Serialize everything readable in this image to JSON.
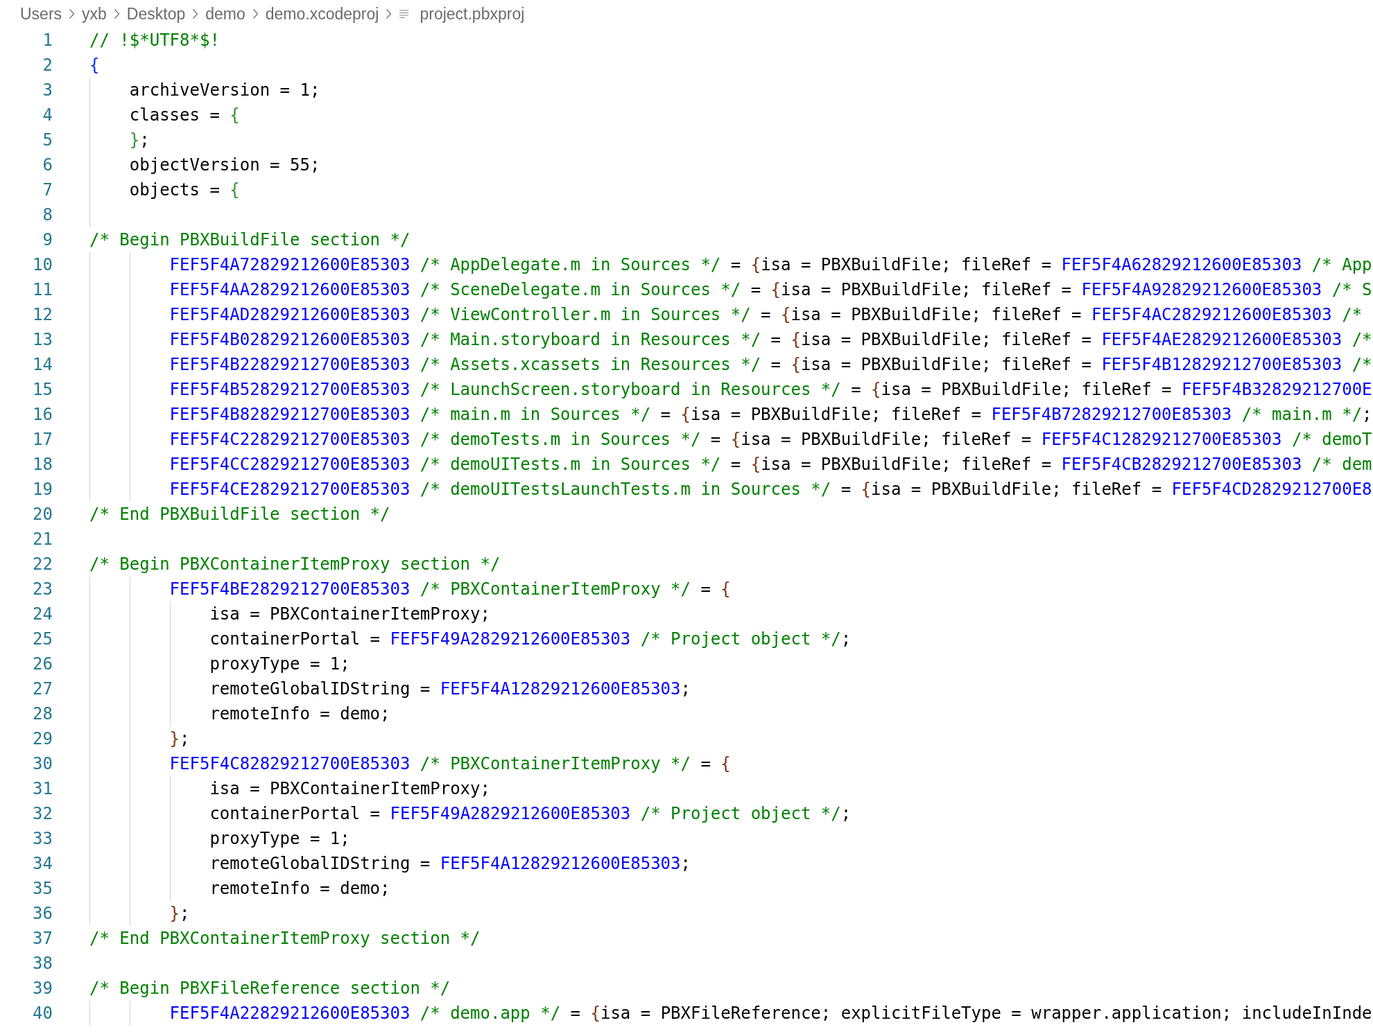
{
  "breadcrumb": {
    "items": [
      {
        "label": "Users",
        "kind": "folder"
      },
      {
        "label": "yxb",
        "kind": "folder"
      },
      {
        "label": "Desktop",
        "kind": "folder"
      },
      {
        "label": "demo",
        "kind": "folder"
      },
      {
        "label": "demo.xcodeproj",
        "kind": "folder"
      },
      {
        "label": "project.pbxproj",
        "kind": "file"
      }
    ]
  },
  "editor": {
    "lines": [
      {
        "number": "1",
        "tokens": [
          {
            "kind": "comment",
            "text": "// !$*UTF8*$!"
          }
        ]
      },
      {
        "number": "2",
        "tokens": [
          {
            "kind": "brace1",
            "text": "{"
          }
        ]
      },
      {
        "number": "3",
        "tokens": [
          {
            "kind": "plain",
            "text": "    archiveVersion = 1;"
          }
        ]
      },
      {
        "number": "4",
        "tokens": [
          {
            "kind": "plain",
            "text": "    classes = "
          },
          {
            "kind": "brace2",
            "text": "{"
          }
        ]
      },
      {
        "number": "5",
        "tokens": [
          {
            "kind": "brace2",
            "text": "    }"
          },
          {
            "kind": "plain",
            "text": ";"
          }
        ]
      },
      {
        "number": "6",
        "tokens": [
          {
            "kind": "plain",
            "text": "    objectVersion = 55;"
          }
        ]
      },
      {
        "number": "7",
        "tokens": [
          {
            "kind": "plain",
            "text": "    objects = "
          },
          {
            "kind": "brace2",
            "text": "{"
          }
        ]
      },
      {
        "number": "8"
      },
      {
        "number": "9",
        "tokens": [
          {
            "kind": "comment",
            "text": "/* Begin PBXBuildFile section */"
          }
        ]
      },
      {
        "number": "10",
        "tokens": [
          {
            "kind": "id",
            "text": "        FEF5F4A72829212600E85303"
          },
          {
            "kind": "comment",
            "text": " /* AppDelegate.m in Sources */"
          },
          {
            "kind": "plain",
            "text": " = "
          },
          {
            "kind": "brace3",
            "text": "{"
          },
          {
            "kind": "plain",
            "text": "isa = PBXBuildFile; fileRef = "
          },
          {
            "kind": "id",
            "text": "FEF5F4A62829212600E85303"
          },
          {
            "kind": "comment",
            "text": " /* App"
          }
        ]
      },
      {
        "number": "11",
        "tokens": [
          {
            "kind": "id",
            "text": "        FEF5F4AA2829212600E85303"
          },
          {
            "kind": "comment",
            "text": " /* SceneDelegate.m in Sources */"
          },
          {
            "kind": "plain",
            "text": " = "
          },
          {
            "kind": "brace3",
            "text": "{"
          },
          {
            "kind": "plain",
            "text": "isa = PBXBuildFile; fileRef = "
          },
          {
            "kind": "id",
            "text": "FEF5F4A92829212600E85303"
          },
          {
            "kind": "comment",
            "text": " /* S"
          }
        ]
      },
      {
        "number": "12",
        "tokens": [
          {
            "kind": "id",
            "text": "        FEF5F4AD2829212600E85303"
          },
          {
            "kind": "comment",
            "text": " /* ViewController.m in Sources */"
          },
          {
            "kind": "plain",
            "text": " = "
          },
          {
            "kind": "brace3",
            "text": "{"
          },
          {
            "kind": "plain",
            "text": "isa = PBXBuildFile; fileRef = "
          },
          {
            "kind": "id",
            "text": "FEF5F4AC2829212600E85303"
          },
          {
            "kind": "comment",
            "text": " /*"
          }
        ]
      },
      {
        "number": "13",
        "tokens": [
          {
            "kind": "id",
            "text": "        FEF5F4B02829212600E85303"
          },
          {
            "kind": "comment",
            "text": " /* Main.storyboard in Resources */"
          },
          {
            "kind": "plain",
            "text": " = "
          },
          {
            "kind": "brace3",
            "text": "{"
          },
          {
            "kind": "plain",
            "text": "isa = PBXBuildFile; fileRef = "
          },
          {
            "kind": "id",
            "text": "FEF5F4AE2829212600E85303"
          },
          {
            "kind": "comment",
            "text": " /*"
          }
        ]
      },
      {
        "number": "14",
        "tokens": [
          {
            "kind": "id",
            "text": "        FEF5F4B22829212700E85303"
          },
          {
            "kind": "comment",
            "text": " /* Assets.xcassets in Resources */"
          },
          {
            "kind": "plain",
            "text": " = "
          },
          {
            "kind": "brace3",
            "text": "{"
          },
          {
            "kind": "plain",
            "text": "isa = PBXBuildFile; fileRef = "
          },
          {
            "kind": "id",
            "text": "FEF5F4B12829212700E85303"
          },
          {
            "kind": "comment",
            "text": " /*"
          }
        ]
      },
      {
        "number": "15",
        "tokens": [
          {
            "kind": "id",
            "text": "        FEF5F4B52829212700E85303"
          },
          {
            "kind": "comment",
            "text": " /* LaunchScreen.storyboard in Resources */"
          },
          {
            "kind": "plain",
            "text": " = "
          },
          {
            "kind": "brace3",
            "text": "{"
          },
          {
            "kind": "plain",
            "text": "isa = PBXBuildFile; fileRef = "
          },
          {
            "kind": "id",
            "text": "FEF5F4B32829212700E"
          }
        ]
      },
      {
        "number": "16",
        "tokens": [
          {
            "kind": "id",
            "text": "        FEF5F4B82829212700E85303"
          },
          {
            "kind": "comment",
            "text": " /* main.m in Sources */"
          },
          {
            "kind": "plain",
            "text": " = "
          },
          {
            "kind": "brace3",
            "text": "{"
          },
          {
            "kind": "plain",
            "text": "isa = PBXBuildFile; fileRef = "
          },
          {
            "kind": "id",
            "text": "FEF5F4B72829212700E85303"
          },
          {
            "kind": "comment",
            "text": " /* main.m */"
          },
          {
            "kind": "plain",
            "text": ";"
          }
        ]
      },
      {
        "number": "17",
        "tokens": [
          {
            "kind": "id",
            "text": "        FEF5F4C22829212700E85303"
          },
          {
            "kind": "comment",
            "text": " /* demoTests.m in Sources */"
          },
          {
            "kind": "plain",
            "text": " = "
          },
          {
            "kind": "brace3",
            "text": "{"
          },
          {
            "kind": "plain",
            "text": "isa = PBXBuildFile; fileRef = "
          },
          {
            "kind": "id",
            "text": "FEF5F4C12829212700E85303"
          },
          {
            "kind": "comment",
            "text": " /* demoT"
          }
        ]
      },
      {
        "number": "18",
        "tokens": [
          {
            "kind": "id",
            "text": "        FEF5F4CC2829212700E85303"
          },
          {
            "kind": "comment",
            "text": " /* demoUITests.m in Sources */"
          },
          {
            "kind": "plain",
            "text": " = "
          },
          {
            "kind": "brace3",
            "text": "{"
          },
          {
            "kind": "plain",
            "text": "isa = PBXBuildFile; fileRef = "
          },
          {
            "kind": "id",
            "text": "FEF5F4CB2829212700E85303"
          },
          {
            "kind": "comment",
            "text": " /* dem"
          }
        ]
      },
      {
        "number": "19",
        "tokens": [
          {
            "kind": "id",
            "text": "        FEF5F4CE2829212700E85303"
          },
          {
            "kind": "comment",
            "text": " /* demoUITestsLaunchTests.m in Sources */"
          },
          {
            "kind": "plain",
            "text": " = "
          },
          {
            "kind": "brace3",
            "text": "{"
          },
          {
            "kind": "plain",
            "text": "isa = PBXBuildFile; fileRef = "
          },
          {
            "kind": "id",
            "text": "FEF5F4CD2829212700E8"
          }
        ]
      },
      {
        "number": "20",
        "tokens": [
          {
            "kind": "comment",
            "text": "/* End PBXBuildFile section */"
          }
        ]
      },
      {
        "number": "21"
      },
      {
        "number": "22",
        "tokens": [
          {
            "kind": "comment",
            "text": "/* Begin PBXContainerItemProxy section */"
          }
        ]
      },
      {
        "number": "23",
        "tokens": [
          {
            "kind": "id",
            "text": "        FEF5F4BE2829212700E85303"
          },
          {
            "kind": "comment",
            "text": " /* PBXContainerItemProxy */"
          },
          {
            "kind": "plain",
            "text": " = "
          },
          {
            "kind": "brace3",
            "text": "{"
          }
        ]
      },
      {
        "number": "24",
        "tokens": [
          {
            "kind": "plain",
            "text": "            isa = PBXContainerItemProxy;"
          }
        ]
      },
      {
        "number": "25",
        "tokens": [
          {
            "kind": "plain",
            "text": "            containerPortal = "
          },
          {
            "kind": "id",
            "text": "FEF5F49A2829212600E85303"
          },
          {
            "kind": "comment",
            "text": " /* Project object */"
          },
          {
            "kind": "plain",
            "text": ";"
          }
        ]
      },
      {
        "number": "26",
        "tokens": [
          {
            "kind": "plain",
            "text": "            proxyType = 1;"
          }
        ]
      },
      {
        "number": "27",
        "tokens": [
          {
            "kind": "plain",
            "text": "            remoteGlobalIDString = "
          },
          {
            "kind": "id",
            "text": "FEF5F4A12829212600E85303"
          },
          {
            "kind": "plain",
            "text": ";"
          }
        ]
      },
      {
        "number": "28",
        "tokens": [
          {
            "kind": "plain",
            "text": "            remoteInfo = demo;"
          }
        ]
      },
      {
        "number": "29",
        "tokens": [
          {
            "kind": "brace3",
            "text": "        }"
          },
          {
            "kind": "plain",
            "text": ";"
          }
        ]
      },
      {
        "number": "30",
        "tokens": [
          {
            "kind": "id",
            "text": "        FEF5F4C82829212700E85303"
          },
          {
            "kind": "comment",
            "text": " /* PBXContainerItemProxy */"
          },
          {
            "kind": "plain",
            "text": " = "
          },
          {
            "kind": "brace3",
            "text": "{"
          }
        ]
      },
      {
        "number": "31",
        "tokens": [
          {
            "kind": "plain",
            "text": "            isa = PBXContainerItemProxy;"
          }
        ]
      },
      {
        "number": "32",
        "tokens": [
          {
            "kind": "plain",
            "text": "            containerPortal = "
          },
          {
            "kind": "id",
            "text": "FEF5F49A2829212600E85303"
          },
          {
            "kind": "comment",
            "text": " /* Project object */"
          },
          {
            "kind": "plain",
            "text": ";"
          }
        ]
      },
      {
        "number": "33",
        "tokens": [
          {
            "kind": "plain",
            "text": "            proxyType = 1;"
          }
        ]
      },
      {
        "number": "34",
        "tokens": [
          {
            "kind": "plain",
            "text": "            remoteGlobalIDString = "
          },
          {
            "kind": "id",
            "text": "FEF5F4A12829212600E85303"
          },
          {
            "kind": "plain",
            "text": ";"
          }
        ]
      },
      {
        "number": "35",
        "tokens": [
          {
            "kind": "plain",
            "text": "            remoteInfo = demo;"
          }
        ]
      },
      {
        "number": "36",
        "tokens": [
          {
            "kind": "brace3",
            "text": "        }"
          },
          {
            "kind": "plain",
            "text": ";"
          }
        ]
      },
      {
        "number": "37",
        "tokens": [
          {
            "kind": "comment",
            "text": "/* End PBXContainerItemProxy section */"
          }
        ]
      },
      {
        "number": "38"
      },
      {
        "number": "39",
        "tokens": [
          {
            "kind": "comment",
            "text": "/* Begin PBXFileReference section */"
          }
        ]
      },
      {
        "number": "40",
        "tokens": [
          {
            "kind": "id",
            "text": "        FEF5F4A22829212600E85303"
          },
          {
            "kind": "comment",
            "text": " /* demo.app */"
          },
          {
            "kind": "plain",
            "text": " = "
          },
          {
            "kind": "brace3",
            "text": "{"
          },
          {
            "kind": "plain",
            "text": "isa = PBXFileReference; explicitFileType = wrapper.application; includeInInde"
          }
        ]
      }
    ]
  }
}
